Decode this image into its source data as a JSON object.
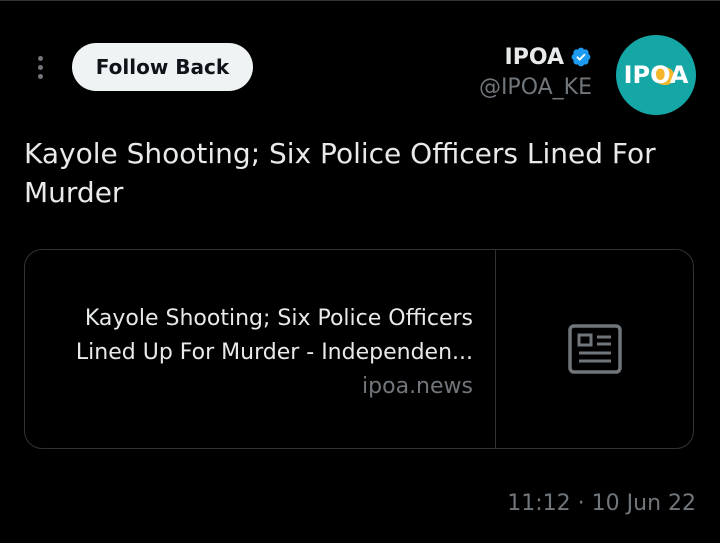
{
  "header": {
    "more_icon": "more-vertical-icon",
    "follow_button_label": "Follow Back",
    "display_name": "IPOA",
    "verified_icon": "verified-badge-icon",
    "handle": "@IPOA_KE",
    "avatar": {
      "text": "IPOA",
      "background_color": "#14a7a6",
      "accent_color": "#f5b62a"
    }
  },
  "tweet": {
    "text": "Kayole Shooting; Six Police Officers Lined For Murder"
  },
  "link_card": {
    "title": "Kayole Shooting; Six Police Officers Lined Up For Murder - Independen...",
    "domain": "ipoa.news",
    "thumbnail_icon": "news-article-icon"
  },
  "meta": {
    "timestamp": "11:12 · 10 Jun 22"
  },
  "colors": {
    "background": "#000000",
    "primary_text": "#e7e9ea",
    "secondary_text": "#71767b",
    "border": "#2f3336",
    "verified_blue": "#1d9bf0"
  }
}
